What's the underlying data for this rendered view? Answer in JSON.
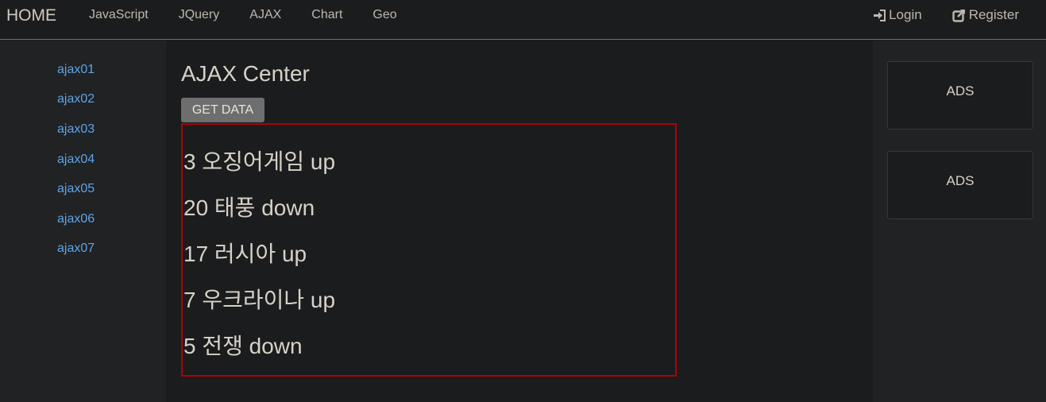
{
  "navbar": {
    "brand": "HOME",
    "links": [
      "JavaScript",
      "JQuery",
      "AJAX",
      "Chart",
      "Geo"
    ],
    "right": {
      "login": {
        "label": "Login",
        "icon": "sign-in-icon"
      },
      "register": {
        "label": "Register",
        "icon": "edit-icon"
      }
    }
  },
  "sidebar": {
    "items": [
      "ajax01",
      "ajax02",
      "ajax03",
      "ajax04",
      "ajax05",
      "ajax06",
      "ajax07"
    ]
  },
  "main": {
    "title": "AJAX Center",
    "button_label": "GET DATA",
    "results": [
      "3 오징어게임 up",
      "20 태풍 down",
      "17 러시아 up",
      "7 우크라이나 up",
      "5 전쟁 down"
    ]
  },
  "ads": [
    "ADS",
    "ADS"
  ],
  "colors": {
    "background": "#1b1c1e",
    "sidebar_bg": "#202224",
    "link": "#5ea4e5",
    "result_border": "#b40000",
    "button_bg": "#6e6e6e"
  }
}
